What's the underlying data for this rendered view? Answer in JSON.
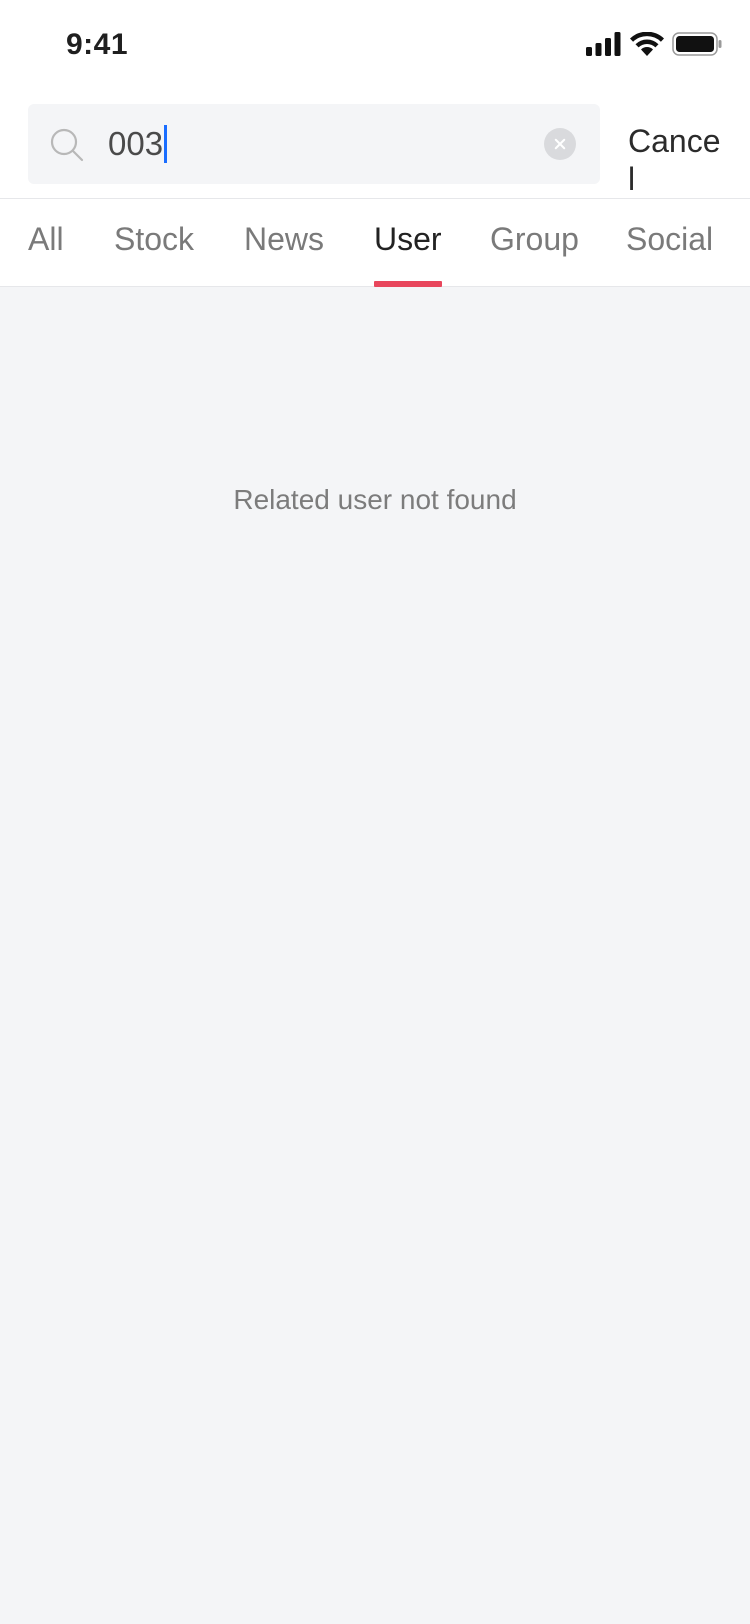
{
  "status_bar": {
    "time": "9:41",
    "icons": [
      "signal-icon",
      "wifi-icon",
      "battery-icon"
    ]
  },
  "search": {
    "value": "003",
    "cancel_label": "Cancel",
    "icon": "search-icon",
    "clear_icon": "clear-icon"
  },
  "tabs": [
    {
      "label": "All"
    },
    {
      "label": "Stock"
    },
    {
      "label": "News"
    },
    {
      "label": "User",
      "active": true
    },
    {
      "label": "Group"
    },
    {
      "label": "Social"
    }
  ],
  "empty_state": {
    "message": "Related user not found"
  },
  "colors": {
    "accent": "#e8465c",
    "caret": "#1a6dff",
    "background": "#f4f5f7"
  }
}
